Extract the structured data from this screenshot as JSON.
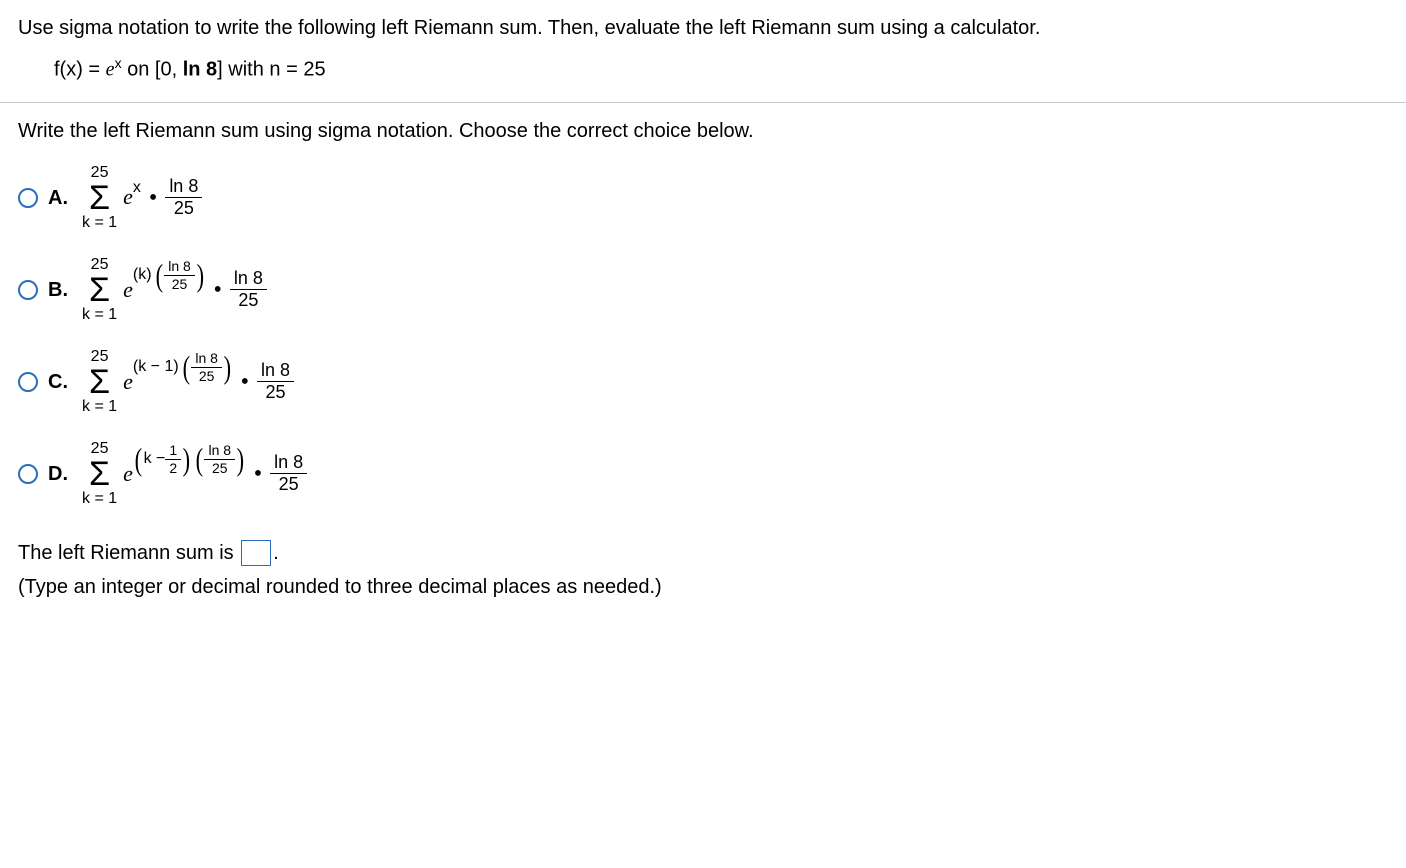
{
  "problem": {
    "statement": "Use sigma notation to write the following left Riemann sum. Then, evaluate the left Riemann sum using a calculator.",
    "func_prefix": "f(x) = ",
    "func_e": "e",
    "func_sup": "x",
    "func_on": " on [0, ",
    "ln8_bold": "ln 8",
    "func_close": "] with n = 25"
  },
  "prompt2": "Write the left Riemann sum using sigma notation. Choose the correct choice below.",
  "sigma": {
    "top": "25",
    "sym": "Σ",
    "bottom": "k = 1"
  },
  "ln8": "ln 8",
  "n25": "25",
  "opts": {
    "A": {
      "label": "A.",
      "exp": "x"
    },
    "B": {
      "label": "B.",
      "exp_pre": "(k)"
    },
    "C": {
      "label": "C.",
      "exp_pre": "(k − 1)"
    },
    "D": {
      "label": "D.",
      "k": "k − ",
      "half_num": "1",
      "half_den": "2"
    }
  },
  "e": "e",
  "bottom": {
    "line1_a": "The left Riemann sum is ",
    "line1_b": ".",
    "line2": "(Type an integer or decimal rounded to three decimal places as needed.)"
  }
}
